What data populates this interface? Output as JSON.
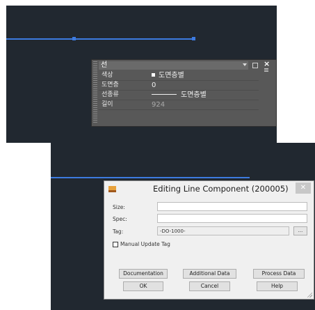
{
  "palette": {
    "title": "선",
    "rows": [
      {
        "label": "색상",
        "value": "도면층별"
      },
      {
        "label": "도면층",
        "value": "0"
      },
      {
        "label": "선종류",
        "value": "도면층별"
      },
      {
        "label": "길이",
        "value": "924"
      }
    ]
  },
  "dialog": {
    "title": "Editing Line Component (200005)",
    "close_label": "✕",
    "fields": {
      "size_label": "Size:",
      "size_value": "",
      "spec_label": "Spec:",
      "spec_value": "",
      "tag_label": "Tag:",
      "tag_value": "-DO-1000-",
      "browse_label": "..."
    },
    "manual_update_tag": {
      "label": "Manual Update Tag",
      "checked": false
    },
    "buttons": {
      "documentation": "Documentation",
      "additional_data": "Additional Data",
      "process_data": "Process Data",
      "ok": "OK",
      "cancel": "Cancel",
      "help": "Help"
    }
  },
  "colors": {
    "viewport_bg": "#212830",
    "line": "#3d7be0",
    "palette_bg": "#585858",
    "dialog_bg": "#f0f0f0"
  }
}
